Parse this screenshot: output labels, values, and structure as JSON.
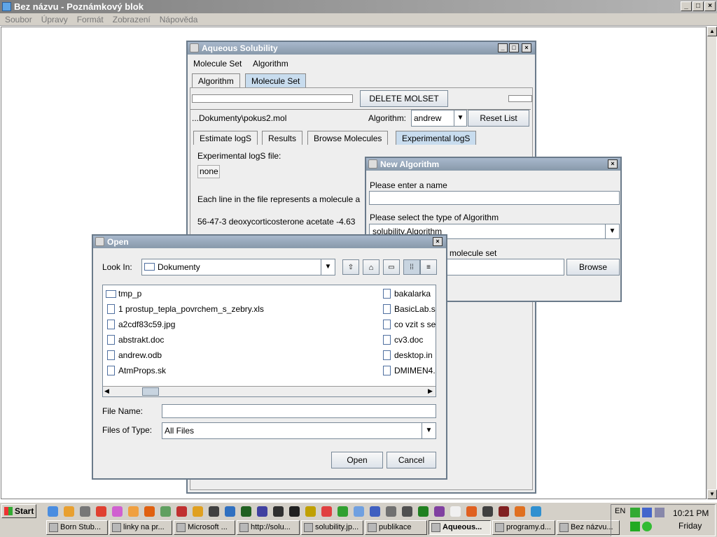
{
  "notepad": {
    "title": "Bez názvu - Poznámkový blok",
    "menu": [
      "Soubor",
      "Úpravy",
      "Formát",
      "Zobrazení",
      "Nápověda"
    ]
  },
  "aqueous": {
    "title": "Aqueous Solubility",
    "menu": [
      "Molecule Set",
      "Algorithm"
    ],
    "tabs": [
      "Algorithm",
      "Molecule Set"
    ],
    "delete_button": "DELETE MOLSET",
    "file_path": "...Dokumenty\\pokus2.mol",
    "algorithm_label": "Algorithm:",
    "algorithm_value": "andrew",
    "reset_button": "Reset List",
    "subtabs": [
      "Estimate logS",
      "Results",
      "Browse Molecules",
      "Experimental logS"
    ],
    "exp_file_label": "Experimental logS file:",
    "exp_file_value": "none",
    "line_text": "Each line in the file represents a molecule a",
    "example_text": "56-47-3 deoxycorticosterone acetate -4.63"
  },
  "new_algorithm": {
    "title": "New Algorithm",
    "name_label": "Please enter a name",
    "name_value": "",
    "type_label": "Please select the type of Algorithm",
    "type_value": "solubility.Algorithm",
    "molset_label": "molecule set",
    "browse_button": "Browse"
  },
  "open_dialog": {
    "title": "Open",
    "look_in_label": "Look In:",
    "look_in_value": "Dokumenty",
    "files_left": [
      {
        "name": "tmp_p",
        "type": "folder"
      },
      {
        "name": "1 prostup_tepla_povrchem_s_zebry.xls",
        "type": "file"
      },
      {
        "name": "a2cdf83c59.jpg",
        "type": "file"
      },
      {
        "name": "abstrakt.doc",
        "type": "file"
      },
      {
        "name": "andrew.odb",
        "type": "file"
      },
      {
        "name": "AtmProps.sk",
        "type": "file"
      }
    ],
    "files_right": [
      "bakalarka",
      "BasicLab.s",
      "co vzit s se",
      "cv3.doc",
      "desktop.in",
      "DMIMEN4.c"
    ],
    "file_name_label": "File Name:",
    "file_name_value": "",
    "files_of_type_label": "Files of Type:",
    "files_of_type_value": "All Files",
    "open_button": "Open",
    "cancel_button": "Cancel"
  },
  "taskbar": {
    "start": "Start",
    "tasks": [
      "Born Stub...",
      "linky na pr...",
      "Microsoft ...",
      "http://solu...",
      "solubility.jp...",
      "publikace",
      "Aqueous...",
      "programy.d...",
      "Bez názvu..."
    ],
    "lang": "EN",
    "time": "10:21 PM",
    "day": "Friday"
  }
}
